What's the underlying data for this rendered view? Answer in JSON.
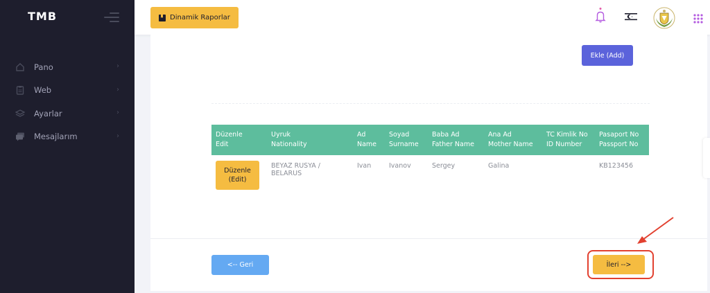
{
  "sidebar": {
    "logo": "TMB",
    "items": [
      {
        "label": "Pano",
        "icon": "home-icon"
      },
      {
        "label": "Web",
        "icon": "clipboard-icon"
      },
      {
        "label": "Ayarlar",
        "icon": "layers-icon"
      },
      {
        "label": "Mesajlarım",
        "icon": "chat-icon"
      }
    ]
  },
  "topbar": {
    "reports_label": "Dinamik Raporlar"
  },
  "content": {
    "add_label": "Ekle (Add)",
    "table": {
      "headers": [
        [
          "Düzenle",
          "Edit"
        ],
        [
          "Uyruk",
          "Nationality"
        ],
        [
          "Ad",
          "Name"
        ],
        [
          "Soyad",
          "Surname"
        ],
        [
          "Baba Ad",
          "Father Name"
        ],
        [
          "Ana Ad",
          "Mother Name"
        ],
        [
          "TC Kimlik No",
          "ID Number"
        ],
        [
          "Pasaport No",
          "Passport No"
        ]
      ],
      "rows": [
        {
          "edit_label_1": "Düzenle",
          "edit_label_2": "(Edit)",
          "nationality": "BEYAZ RUSYA / BELARUS",
          "name": "Ivan",
          "surname": "Ivanov",
          "father": "Sergey",
          "mother": "Galina",
          "id_number": "",
          "passport": "KB123456"
        }
      ]
    },
    "back_label": "<-- Geri",
    "next_label": "İleri -->"
  },
  "colors": {
    "sidebar_bg": "#1e1e2d",
    "accent_yellow": "#f5bc41",
    "add_button": "#5b63db",
    "table_header": "#5dbd9d",
    "back_button": "#64a9f2",
    "highlight_red": "#e2402f"
  }
}
